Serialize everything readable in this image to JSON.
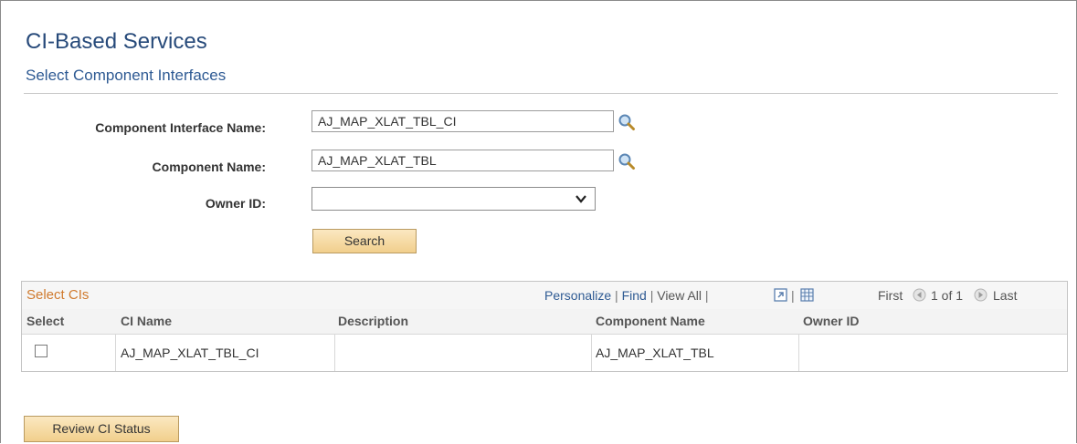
{
  "page": {
    "title": "CI-Based Services",
    "subtitle": "Select Component Interfaces"
  },
  "form": {
    "ci_name_label": "Component Interface Name:",
    "ci_name_value": "AJ_MAP_XLAT_TBL_CI",
    "component_name_label": "Component Name:",
    "component_name_value": "AJ_MAP_XLAT_TBL",
    "owner_id_label": "Owner ID:",
    "owner_id_value": "",
    "search_label": "Search"
  },
  "grid": {
    "title": "Select CIs",
    "nav": {
      "personalize": "Personalize",
      "find": "Find",
      "view_all": "View All",
      "sep": "|",
      "first": "First",
      "range": "1 of 1",
      "last": "Last"
    },
    "columns": [
      "Select",
      "CI Name",
      "Description",
      "Component Name",
      "Owner ID"
    ],
    "rows": [
      {
        "select": false,
        "ci_name": "AJ_MAP_XLAT_TBL_CI",
        "description": "",
        "component_name": "AJ_MAP_XLAT_TBL",
        "owner_id": ""
      }
    ]
  },
  "footer": {
    "review_label": "Review CI Status"
  },
  "icons": {
    "lookup": "magnifier-icon",
    "dropdown": "chevron-down-icon",
    "zoom": "zoom-icon",
    "download": "spreadsheet-icon",
    "prev": "previous-arrow-icon",
    "next": "next-arrow-icon"
  }
}
